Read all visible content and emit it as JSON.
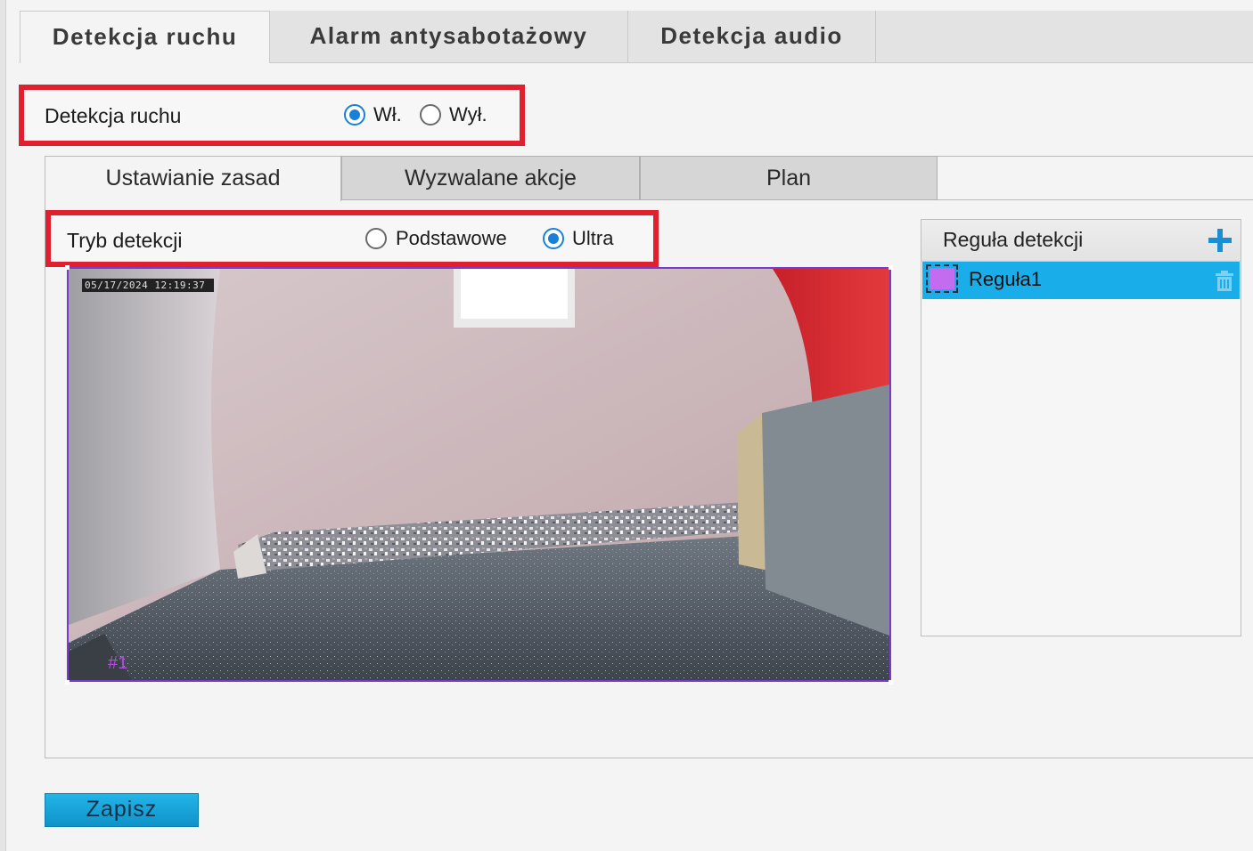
{
  "top_tabs": [
    {
      "label": "Detekcja ruchu",
      "active": true
    },
    {
      "label": "Alarm antysabotażowy",
      "active": false
    },
    {
      "label": "Detekcja audio",
      "active": false
    }
  ],
  "motion": {
    "label": "Detekcja ruchu",
    "on_label": "Wł.",
    "off_label": "Wył.",
    "selected": "on"
  },
  "sub_tabs": [
    {
      "label": "Ustawianie zasad",
      "active": true
    },
    {
      "label": "Wyzwalane akcje",
      "active": false
    },
    {
      "label": "Plan",
      "active": false
    }
  ],
  "mode": {
    "label": "Tryb detekcji",
    "basic_label": "Podstawowe",
    "ultra_label": "Ultra",
    "selected": "ultra"
  },
  "video": {
    "osd_timestamp": "05/17/2024 12:19:37",
    "zone_tag": "#1"
  },
  "rules": {
    "title": "Reguła detekcji",
    "add_icon": "plus-icon",
    "items": [
      {
        "name": "Reguła1",
        "color": "#c46cf0",
        "delete_icon": "trash-icon"
      }
    ]
  },
  "save_label": "Zapisz",
  "colors": {
    "highlight_border": "#e0202e",
    "accent": "#1a7fd6",
    "selected_row": "#19aeea",
    "zone_color": "#7a3cc8"
  }
}
